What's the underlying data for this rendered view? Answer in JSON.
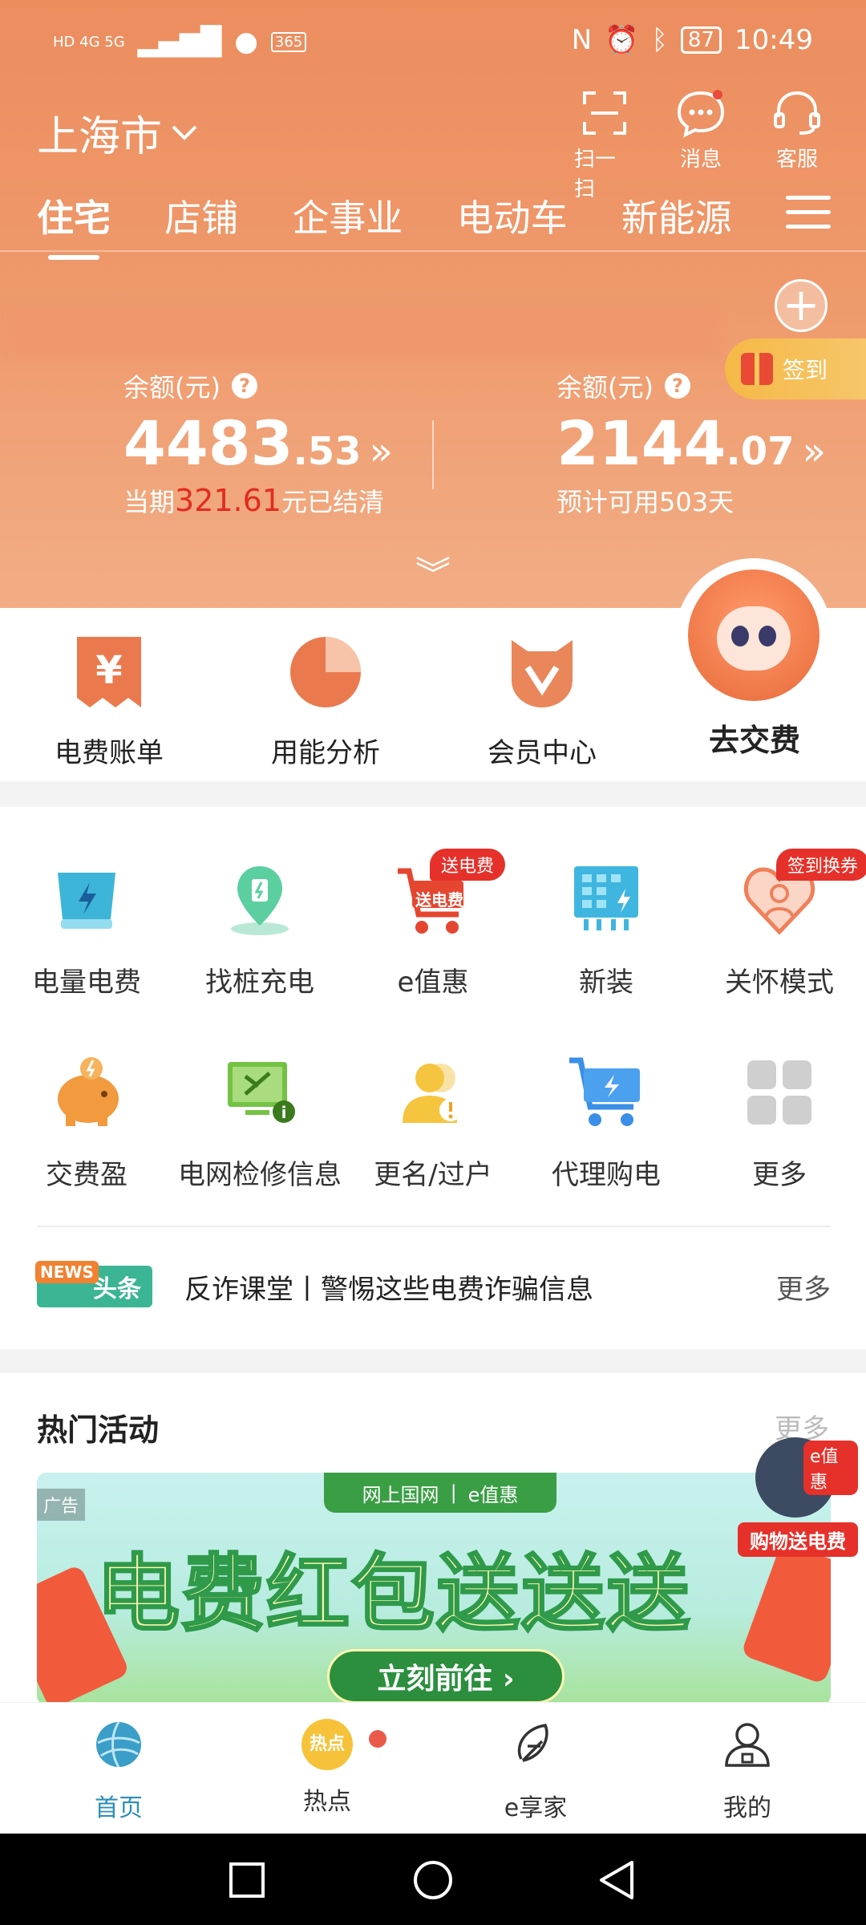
{
  "status_bar": {
    "network_label": "HD 4G 5G",
    "battery": "87",
    "time": "10:49",
    "calendar": "365"
  },
  "header": {
    "city": "上海市",
    "actions": [
      {
        "icon": "scan-icon",
        "label": "扫一扫"
      },
      {
        "icon": "message-icon",
        "label": "消息"
      },
      {
        "icon": "headset-icon",
        "label": "客服"
      }
    ],
    "tabs": [
      "住宅",
      "店铺",
      "企事业",
      "电动车",
      "新能源"
    ],
    "signin_label": "签到"
  },
  "balances": [
    {
      "label": "余额(元)",
      "amount_int": "4483",
      "amount_dec": ".53",
      "sub_prefix": "当期",
      "sub_value": "321.61",
      "sub_suffix": "元已结清"
    },
    {
      "label": "余额(元)",
      "amount_int": "2144",
      "amount_dec": ".07",
      "sub_prefix": "预计可用",
      "sub_value": "503",
      "sub_suffix": "天"
    }
  ],
  "quick": [
    {
      "label": "电费账单",
      "icon": "bill-icon"
    },
    {
      "label": "用能分析",
      "icon": "pie-chart-icon"
    },
    {
      "label": "会员中心",
      "icon": "member-icon"
    },
    {
      "label": "去交费",
      "icon": "mascot-icon"
    }
  ],
  "services": [
    {
      "label": "电量电费",
      "icon": "battery-icon"
    },
    {
      "label": "找桩充电",
      "icon": "charging-pile-icon"
    },
    {
      "label": "e值惠",
      "icon": "cart-icon",
      "badge": "送电费",
      "inner": "送电费"
    },
    {
      "label": "新装",
      "icon": "meter-icon"
    },
    {
      "label": "关怀模式",
      "icon": "care-icon",
      "badge": "签到换券"
    },
    {
      "label": "交费盈",
      "icon": "piggy-icon"
    },
    {
      "label": "电网检修信息",
      "icon": "grid-repair-icon"
    },
    {
      "label": "更名/过户",
      "icon": "user-transfer-icon"
    },
    {
      "label": "代理购电",
      "icon": "proxy-cart-icon"
    },
    {
      "label": "更多",
      "icon": "grid-more-icon"
    }
  ],
  "news": {
    "logo_top": "NEWS",
    "logo_text": "头条",
    "headline": "反诈课堂丨警惕这些电费诈骗信息",
    "more": "更多"
  },
  "hot": {
    "title": "热门活动",
    "more": "更多",
    "ad": "广告",
    "banner_top_left": "网上国网",
    "banner_top_right": "e值惠",
    "banner_title": "电费红包送送送",
    "banner_button": "立刻前往 ›",
    "promo_tag": "e值惠",
    "promo_label": "购物送电费"
  },
  "bottom_nav": [
    {
      "label": "首页",
      "icon": "home-globe-icon",
      "active": true
    },
    {
      "label": "热点",
      "icon": "hot-icon"
    },
    {
      "label": "e享家",
      "icon": "e-home-icon"
    },
    {
      "label": "我的",
      "icon": "profile-icon"
    }
  ],
  "colors": {
    "header_orange": "#ec8d5e",
    "accent_red": "#e32b1e",
    "active_blue": "#2a8fb8"
  }
}
